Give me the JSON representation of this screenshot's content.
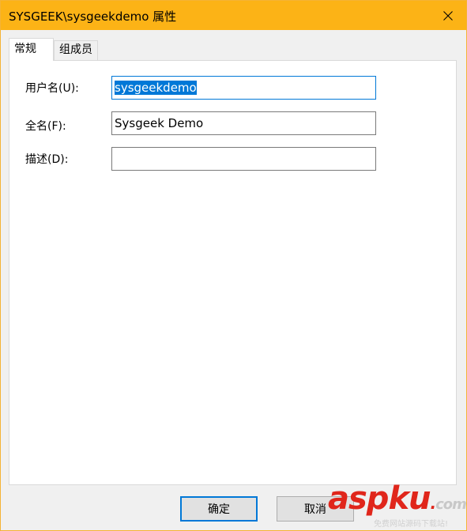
{
  "window": {
    "title": "SYSGEEK\\sysgeekdemo 属性"
  },
  "tabs": [
    {
      "label": "常规",
      "active": true
    },
    {
      "label": "组成员",
      "active": false
    }
  ],
  "fields": {
    "username": {
      "label": "用户名(U):",
      "value": "sysgeekdemo"
    },
    "fullname": {
      "label": "全名(F):",
      "value": "Sysgeek Demo"
    },
    "description": {
      "label": "描述(D):",
      "value": ""
    }
  },
  "buttons": {
    "ok": "确定",
    "cancel": "取消"
  },
  "watermark": {
    "main_a": "asp",
    "main_k": "ku",
    "main_dot": ".",
    "main_com": "com",
    "sub": "免费网站源码下载站!"
  },
  "colors": {
    "titlebar": "#fcb316",
    "accent": "#0078d7",
    "watermark": "#e0261b"
  }
}
